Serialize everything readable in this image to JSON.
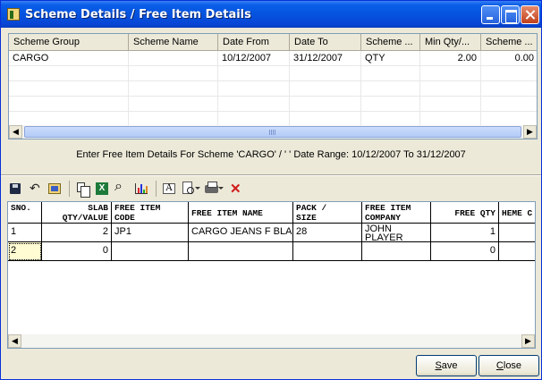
{
  "window": {
    "title": "Scheme Details / Free Item Details"
  },
  "scheme_grid": {
    "columns": [
      "Scheme Group",
      "Scheme Name",
      "Date From",
      "Date To",
      "Scheme ...",
      "Min Qty/...",
      "Scheme ..."
    ],
    "rows": [
      [
        "CARGO",
        "",
        "10/12/2007",
        "31/12/2007",
        "QTY",
        "2.00",
        "0.00"
      ]
    ]
  },
  "info_text": "Enter Free Item Details For Scheme 'CARGO' / ' '   Date Range: 10/12/2007 To 31/12/2007",
  "toolbar": {
    "icons": [
      "save-icon",
      "undo-icon",
      "window-icon",
      "copy-icon",
      "excel-icon",
      "find-icon",
      "chart-icon",
      "font-icon",
      "print-preview-icon",
      "print-icon",
      "delete-icon"
    ],
    "excel_glyph": "X",
    "font_glyph": "A"
  },
  "item_grid": {
    "columns": [
      {
        "line1": "SNO.",
        "line2": ""
      },
      {
        "line1": "SLAB",
        "line2": "QTY/VALUE"
      },
      {
        "line1": "FREE ITEM",
        "line2": "CODE"
      },
      {
        "line1": "FREE ITEM NAME",
        "line2": ""
      },
      {
        "line1": "PACK /",
        "line2": "SIZE"
      },
      {
        "line1": "FREE ITEM",
        "line2": "COMPANY"
      },
      {
        "line1": "FREE QTY",
        "line2": ""
      },
      {
        "line1": "HEME C",
        "line2": ""
      }
    ],
    "rows": [
      [
        "1",
        "2",
        "JP1",
        "CARGO JEANS F BLA",
        "28",
        "JOHN PLAYER",
        "1",
        ""
      ],
      [
        "2",
        "0",
        "",
        "",
        "",
        "",
        "0",
        ""
      ]
    ]
  },
  "buttons": {
    "save_key": "S",
    "save_rest": "ave",
    "close_key": "C",
    "close_rest": "lose"
  },
  "colors": {
    "title_bar": "#0553df",
    "window_bg": "#ece9d8",
    "current_cell": "#fffbd2",
    "delete_icon": "#d01a1a"
  }
}
